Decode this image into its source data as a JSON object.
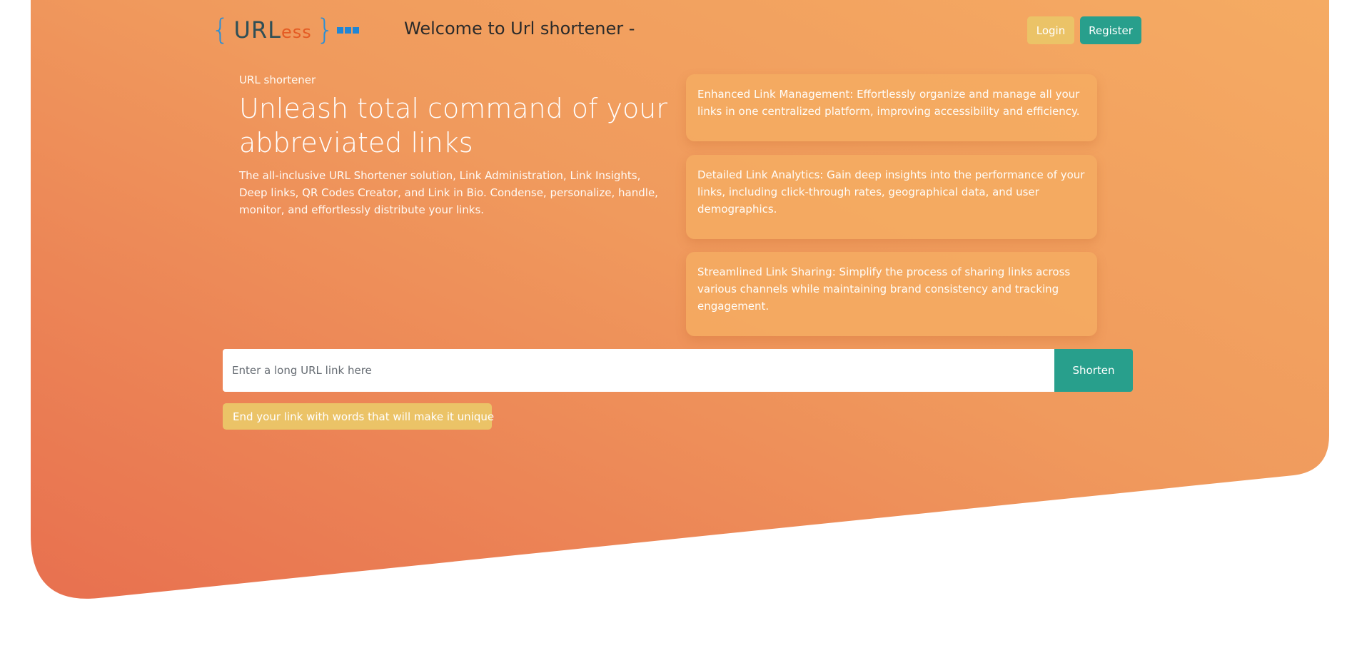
{
  "header": {
    "logo": {
      "brace_open": "{",
      "word_main": "URL",
      "word_accent": "ess",
      "brace_close": "}"
    },
    "welcome_text": "Welcome to Url shortener -",
    "login_label": "Login",
    "register_label": "Register"
  },
  "hero": {
    "eyebrow": "URL shortener",
    "headline": "Unleash total command of your abbreviated links",
    "lead": "The all-inclusive URL Shortener solution, Link Administration, Link Insights, Deep links, QR Codes Creator, and Link in Bio. Condense, personalize, handle, monitor, and effortlessly distribute your links."
  },
  "features": [
    {
      "text": "Enhanced Link Management: Effortlessly organize and manage all your links in one centralized platform, improving accessibility and efficiency."
    },
    {
      "text": "Detailed Link Analytics: Gain deep insights into the performance of your links, including click-through rates, geographical data, and user demographics."
    },
    {
      "text": "Streamlined Link Sharing: Simplify the process of sharing links across various channels while maintaining brand consistency and tracking engagement."
    }
  ],
  "shorten": {
    "placeholder": "Enter a long URL link here",
    "value": "",
    "button_label": "Shorten",
    "custom_alias_label": "End your link with words that will make it unique",
    "custom_alias_icon": "sparkle-icon"
  },
  "colors": {
    "hero_gradient_start": "#e8714f",
    "hero_gradient_end": "#f4a862",
    "accent_teal": "#289f8c",
    "accent_yellow": "#ebc367",
    "logo_blue": "#2a8fd6",
    "logo_orange": "#e45b23"
  }
}
